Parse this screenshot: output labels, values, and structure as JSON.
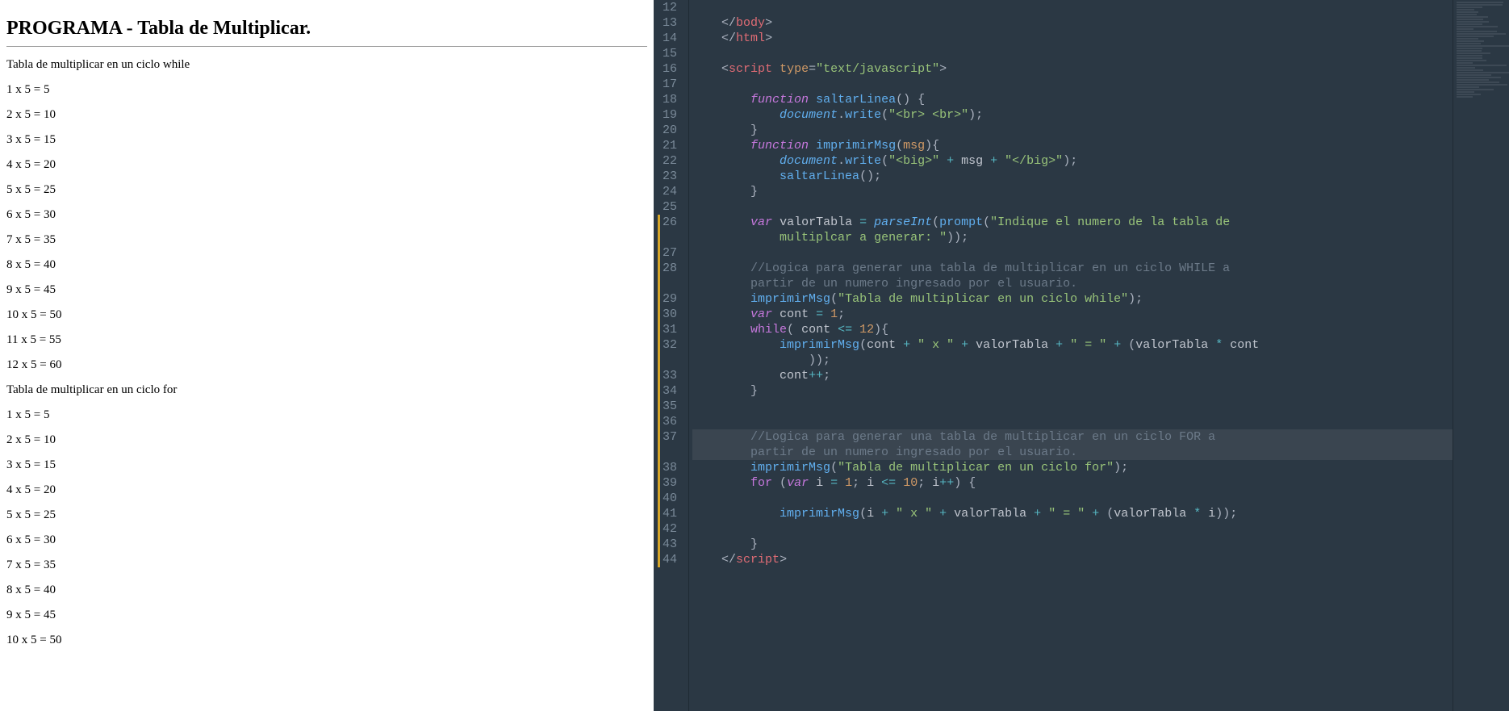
{
  "left": {
    "title": "PROGRAMA - Tabla de Multiplicar.",
    "section1": "Tabla de multiplicar en un ciclo while",
    "whileRows": [
      "1 x 5 = 5",
      "2 x 5 = 10",
      "3 x 5 = 15",
      "4 x 5 = 20",
      "5 x 5 = 25",
      "6 x 5 = 30",
      "7 x 5 = 35",
      "8 x 5 = 40",
      "9 x 5 = 45",
      "10 x 5 = 50",
      "11 x 5 = 55",
      "12 x 5 = 60"
    ],
    "section2": "Tabla de multiplicar en un ciclo for",
    "forRows": [
      "1 x 5 = 5",
      "2 x 5 = 10",
      "3 x 5 = 15",
      "4 x 5 = 20",
      "5 x 5 = 25",
      "6 x 5 = 30",
      "7 x 5 = 35",
      "8 x 5 = 40",
      "9 x 5 = 45",
      "10 x 5 = 50"
    ]
  },
  "editor": {
    "activeLine": 37,
    "lines": [
      {
        "n": 12,
        "tokens": []
      },
      {
        "n": 13,
        "tokens": [
          {
            "t": "    ",
            "c": "txt"
          },
          {
            "t": "</",
            "c": "punc"
          },
          {
            "t": "body",
            "c": "tag"
          },
          {
            "t": ">",
            "c": "punc"
          }
        ]
      },
      {
        "n": 14,
        "tokens": [
          {
            "t": "    ",
            "c": "txt"
          },
          {
            "t": "</",
            "c": "punc"
          },
          {
            "t": "html",
            "c": "tag"
          },
          {
            "t": ">",
            "c": "punc"
          }
        ]
      },
      {
        "n": 15,
        "tokens": []
      },
      {
        "n": 16,
        "tokens": [
          {
            "t": "    ",
            "c": "txt"
          },
          {
            "t": "<",
            "c": "punc"
          },
          {
            "t": "script",
            "c": "tag"
          },
          {
            "t": " ",
            "c": "txt"
          },
          {
            "t": "type",
            "c": "attr"
          },
          {
            "t": "=",
            "c": "punc"
          },
          {
            "t": "\"text/javascript\"",
            "c": "str"
          },
          {
            "t": ">",
            "c": "punc"
          }
        ]
      },
      {
        "n": 17,
        "tokens": []
      },
      {
        "n": 18,
        "tokens": [
          {
            "t": "        ",
            "c": "txt"
          },
          {
            "t": "function",
            "c": "kw"
          },
          {
            "t": " ",
            "c": "txt"
          },
          {
            "t": "saltarLinea",
            "c": "fn"
          },
          {
            "t": "() {",
            "c": "punc"
          }
        ]
      },
      {
        "n": 19,
        "tokens": [
          {
            "t": "            ",
            "c": "txt"
          },
          {
            "t": "document",
            "c": "obj"
          },
          {
            "t": ".",
            "c": "punc"
          },
          {
            "t": "write",
            "c": "fn"
          },
          {
            "t": "(",
            "c": "punc"
          },
          {
            "t": "\"<br> <br>\"",
            "c": "str"
          },
          {
            "t": ");",
            "c": "punc"
          }
        ]
      },
      {
        "n": 20,
        "tokens": [
          {
            "t": "        ",
            "c": "txt"
          },
          {
            "t": "}",
            "c": "punc"
          }
        ]
      },
      {
        "n": 21,
        "tokens": [
          {
            "t": "        ",
            "c": "txt"
          },
          {
            "t": "function",
            "c": "kw"
          },
          {
            "t": " ",
            "c": "txt"
          },
          {
            "t": "imprimirMsg",
            "c": "fn"
          },
          {
            "t": "(",
            "c": "punc"
          },
          {
            "t": "msg",
            "c": "param"
          },
          {
            "t": "){",
            "c": "punc"
          }
        ]
      },
      {
        "n": 22,
        "tokens": [
          {
            "t": "            ",
            "c": "txt"
          },
          {
            "t": "document",
            "c": "obj"
          },
          {
            "t": ".",
            "c": "punc"
          },
          {
            "t": "write",
            "c": "fn"
          },
          {
            "t": "(",
            "c": "punc"
          },
          {
            "t": "\"<big>\"",
            "c": "str"
          },
          {
            "t": " + ",
            "c": "op"
          },
          {
            "t": "msg",
            "c": "txt"
          },
          {
            "t": " + ",
            "c": "op"
          },
          {
            "t": "\"</big>\"",
            "c": "str"
          },
          {
            "t": ");",
            "c": "punc"
          }
        ]
      },
      {
        "n": 23,
        "tokens": [
          {
            "t": "            ",
            "c": "txt"
          },
          {
            "t": "saltarLinea",
            "c": "fn"
          },
          {
            "t": "();",
            "c": "punc"
          }
        ]
      },
      {
        "n": 24,
        "tokens": [
          {
            "t": "        ",
            "c": "txt"
          },
          {
            "t": "}",
            "c": "punc"
          }
        ]
      },
      {
        "n": 25,
        "tokens": []
      },
      {
        "n": 26,
        "tokens": [
          {
            "t": "        ",
            "c": "txt"
          },
          {
            "t": "var",
            "c": "kw"
          },
          {
            "t": " ",
            "c": "txt"
          },
          {
            "t": "valorTabla",
            "c": "txt"
          },
          {
            "t": " = ",
            "c": "op"
          },
          {
            "t": "parseInt",
            "c": "fni"
          },
          {
            "t": "(",
            "c": "punc"
          },
          {
            "t": "prompt",
            "c": "fn"
          },
          {
            "t": "(",
            "c": "punc"
          },
          {
            "t": "\"Indique el numero de la tabla de ",
            "c": "str"
          }
        ],
        "wrap": [
          {
            "t": "            ",
            "c": "txt"
          },
          {
            "t": "multiplcar a generar: \"",
            "c": "str"
          },
          {
            "t": "));",
            "c": "punc"
          }
        ]
      },
      {
        "n": 27,
        "tokens": []
      },
      {
        "n": 28,
        "tokens": [
          {
            "t": "        ",
            "c": "txt"
          },
          {
            "t": "//Logica para generar una tabla de multiplicar en un ciclo WHILE a ",
            "c": "cmt"
          }
        ],
        "wrap": [
          {
            "t": "        ",
            "c": "txt"
          },
          {
            "t": "partir de un numero ingresado por el usuario.",
            "c": "cmt"
          }
        ]
      },
      {
        "n": 29,
        "tokens": [
          {
            "t": "        ",
            "c": "txt"
          },
          {
            "t": "imprimirMsg",
            "c": "fn"
          },
          {
            "t": "(",
            "c": "punc"
          },
          {
            "t": "\"Tabla de multiplicar en un ciclo while\"",
            "c": "str"
          },
          {
            "t": ");",
            "c": "punc"
          }
        ]
      },
      {
        "n": 30,
        "tokens": [
          {
            "t": "        ",
            "c": "txt"
          },
          {
            "t": "var",
            "c": "kw"
          },
          {
            "t": " ",
            "c": "txt"
          },
          {
            "t": "cont",
            "c": "txt"
          },
          {
            "t": " = ",
            "c": "op"
          },
          {
            "t": "1",
            "c": "num"
          },
          {
            "t": ";",
            "c": "punc"
          }
        ]
      },
      {
        "n": 31,
        "tokens": [
          {
            "t": "        ",
            "c": "txt"
          },
          {
            "t": "while",
            "c": "kw2"
          },
          {
            "t": "( ",
            "c": "punc"
          },
          {
            "t": "cont",
            "c": "txt"
          },
          {
            "t": " <= ",
            "c": "op"
          },
          {
            "t": "12",
            "c": "num"
          },
          {
            "t": "){",
            "c": "punc"
          }
        ]
      },
      {
        "n": 32,
        "tokens": [
          {
            "t": "            ",
            "c": "txt"
          },
          {
            "t": "imprimirMsg",
            "c": "fn"
          },
          {
            "t": "(",
            "c": "punc"
          },
          {
            "t": "cont",
            "c": "txt"
          },
          {
            "t": " + ",
            "c": "op"
          },
          {
            "t": "\" x \"",
            "c": "str"
          },
          {
            "t": " + ",
            "c": "op"
          },
          {
            "t": "valorTabla",
            "c": "txt"
          },
          {
            "t": " + ",
            "c": "op"
          },
          {
            "t": "\" = \"",
            "c": "str"
          },
          {
            "t": " + ",
            "c": "op"
          },
          {
            "t": "(",
            "c": "punc"
          },
          {
            "t": "valorTabla",
            "c": "txt"
          },
          {
            "t": " * ",
            "c": "op"
          },
          {
            "t": "cont",
            "c": "txt"
          }
        ],
        "wrap": [
          {
            "t": "                ",
            "c": "txt"
          },
          {
            "t": "));",
            "c": "punc"
          }
        ]
      },
      {
        "n": 33,
        "tokens": [
          {
            "t": "            ",
            "c": "txt"
          },
          {
            "t": "cont",
            "c": "txt"
          },
          {
            "t": "++",
            "c": "op"
          },
          {
            "t": ";",
            "c": "punc"
          }
        ]
      },
      {
        "n": 34,
        "tokens": [
          {
            "t": "        ",
            "c": "txt"
          },
          {
            "t": "}",
            "c": "punc"
          }
        ]
      },
      {
        "n": 35,
        "tokens": []
      },
      {
        "n": 36,
        "tokens": []
      },
      {
        "n": 37,
        "tokens": [
          {
            "t": "        ",
            "c": "txt"
          },
          {
            "t": "//Logica para generar una tabla de multiplicar en un ciclo FOR a ",
            "c": "cmt"
          }
        ],
        "wrap": [
          {
            "t": "        ",
            "c": "txt"
          },
          {
            "t": "partir de un numero ingresado por el usuario.",
            "c": "cmt"
          }
        ]
      },
      {
        "n": 38,
        "tokens": [
          {
            "t": "        ",
            "c": "txt"
          },
          {
            "t": "imprimirMsg",
            "c": "fn"
          },
          {
            "t": "(",
            "c": "punc"
          },
          {
            "t": "\"Tabla de multiplicar en un ciclo for\"",
            "c": "str"
          },
          {
            "t": ");",
            "c": "punc"
          }
        ]
      },
      {
        "n": 39,
        "tokens": [
          {
            "t": "        ",
            "c": "txt"
          },
          {
            "t": "for",
            "c": "kw2"
          },
          {
            "t": " (",
            "c": "punc"
          },
          {
            "t": "var",
            "c": "kw"
          },
          {
            "t": " ",
            "c": "txt"
          },
          {
            "t": "i",
            "c": "txt"
          },
          {
            "t": " = ",
            "c": "op"
          },
          {
            "t": "1",
            "c": "num"
          },
          {
            "t": "; ",
            "c": "punc"
          },
          {
            "t": "i",
            "c": "txt"
          },
          {
            "t": " <= ",
            "c": "op"
          },
          {
            "t": "10",
            "c": "num"
          },
          {
            "t": "; ",
            "c": "punc"
          },
          {
            "t": "i",
            "c": "txt"
          },
          {
            "t": "++",
            "c": "op"
          },
          {
            "t": ") {",
            "c": "punc"
          }
        ]
      },
      {
        "n": 40,
        "tokens": []
      },
      {
        "n": 41,
        "tokens": [
          {
            "t": "            ",
            "c": "txt"
          },
          {
            "t": "imprimirMsg",
            "c": "fn"
          },
          {
            "t": "(",
            "c": "punc"
          },
          {
            "t": "i",
            "c": "txt"
          },
          {
            "t": " + ",
            "c": "op"
          },
          {
            "t": "\" x \"",
            "c": "str"
          },
          {
            "t": " + ",
            "c": "op"
          },
          {
            "t": "valorTabla",
            "c": "txt"
          },
          {
            "t": " + ",
            "c": "op"
          },
          {
            "t": "\" = \"",
            "c": "str"
          },
          {
            "t": " + ",
            "c": "op"
          },
          {
            "t": "(",
            "c": "punc"
          },
          {
            "t": "valorTabla",
            "c": "txt"
          },
          {
            "t": " * ",
            "c": "op"
          },
          {
            "t": "i",
            "c": "txt"
          },
          {
            "t": "));",
            "c": "punc"
          }
        ]
      },
      {
        "n": 42,
        "tokens": []
      },
      {
        "n": 43,
        "tokens": [
          {
            "t": "        ",
            "c": "txt"
          },
          {
            "t": "}",
            "c": "punc"
          }
        ]
      },
      {
        "n": 44,
        "tokens": [
          {
            "t": "    ",
            "c": "txt"
          },
          {
            "t": "</",
            "c": "punc"
          },
          {
            "t": "script",
            "c": "tag"
          },
          {
            "t": ">",
            "c": "punc"
          }
        ]
      }
    ]
  }
}
